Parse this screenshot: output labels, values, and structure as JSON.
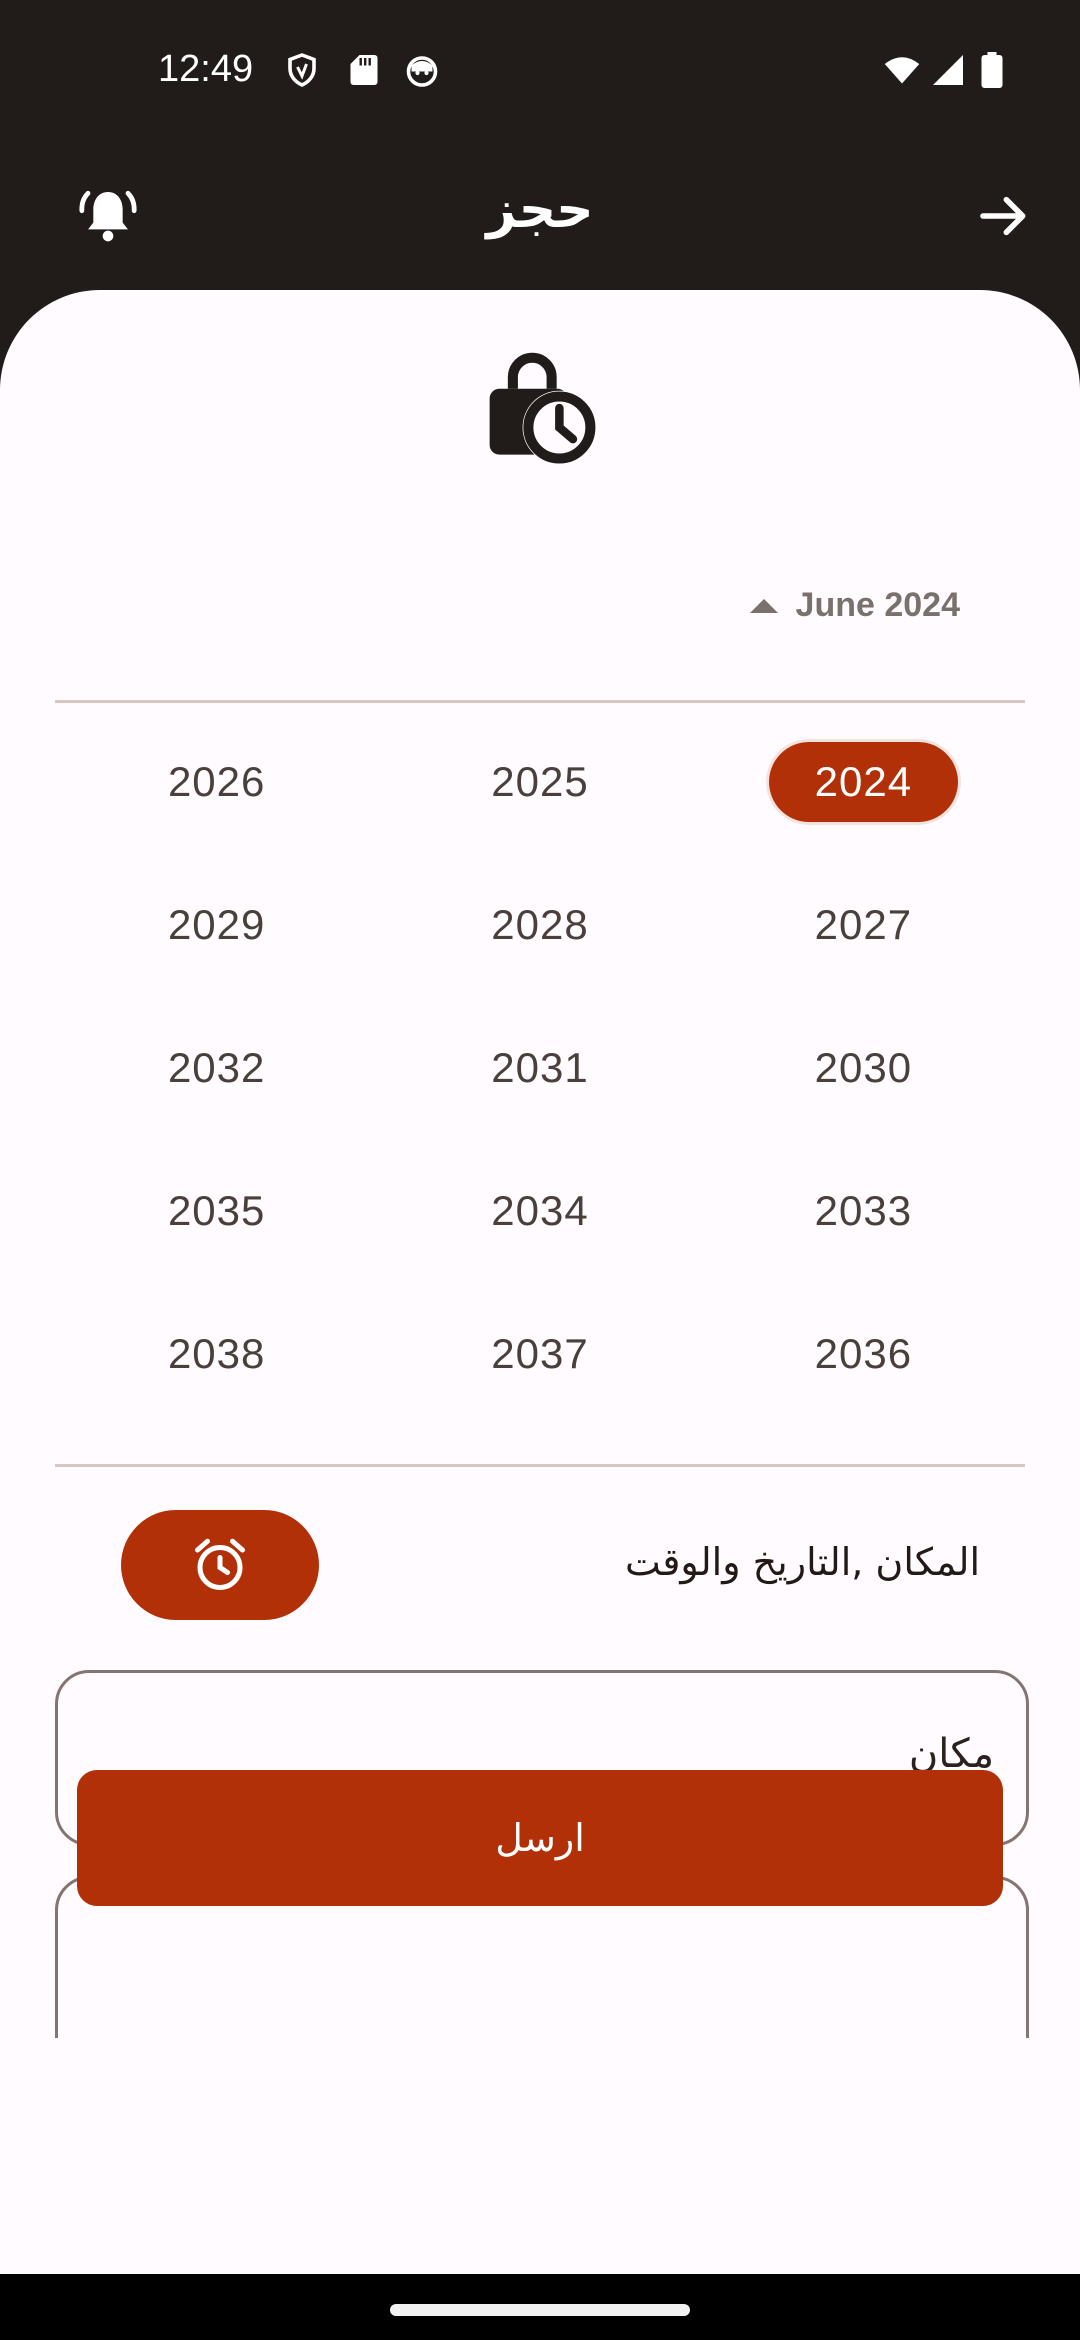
{
  "status_bar": {
    "time": "12:49"
  },
  "app_bar": {
    "title": "حجز"
  },
  "calendar": {
    "month_label": "June 2024",
    "years": [
      "2024",
      "2025",
      "2026",
      "2027",
      "2028",
      "2029",
      "2030",
      "2031",
      "2032",
      "2033",
      "2034",
      "2035",
      "2036",
      "2037",
      "2038"
    ],
    "selected_year": "2024"
  },
  "datetime_row": {
    "label": "المكان ,التاريخ والوقت"
  },
  "form": {
    "place_value": "مكان"
  },
  "submit": {
    "label": "ارسل"
  },
  "colors": {
    "accent": "#b23008",
    "header_bg": "#211b19",
    "sheet_bg": "#fffbfe"
  },
  "icons": [
    "shield-icon",
    "sd-card-icon",
    "cat-face-icon",
    "wifi-icon",
    "signal-icon",
    "battery-icon",
    "bell-ringing-icon",
    "arrow-forward-icon",
    "lock-clock-icon",
    "alarm-clock-icon"
  ]
}
